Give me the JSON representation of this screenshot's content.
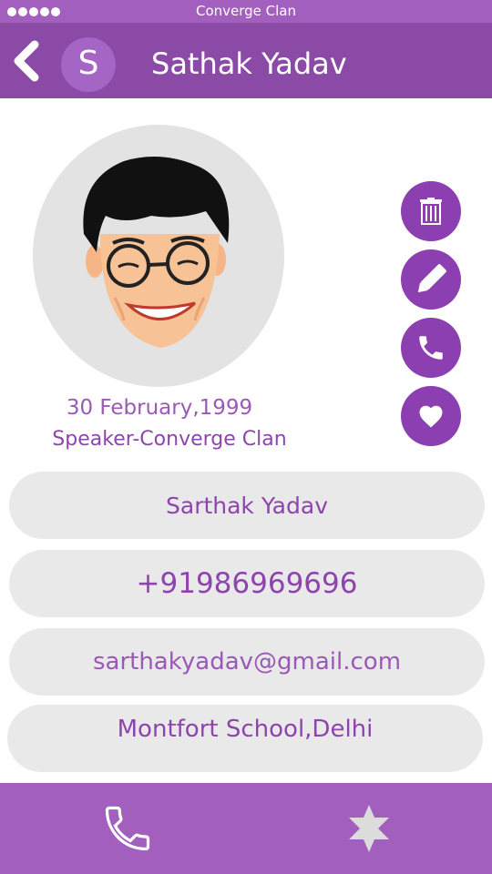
{
  "status_bar": {
    "title": "Converge Clan",
    "signal_dots": 5
  },
  "header": {
    "avatar_initial": "S",
    "title": "Sathak Yadav",
    "back_icon": "chevron-left-icon"
  },
  "profile": {
    "birth_date": "30 February,1999",
    "role": "Speaker-Converge Clan"
  },
  "actions": [
    {
      "name": "delete",
      "icon": "trash-icon"
    },
    {
      "name": "edit",
      "icon": "pencil-icon"
    },
    {
      "name": "call",
      "icon": "phone-icon"
    },
    {
      "name": "favorite",
      "icon": "heart-icon"
    }
  ],
  "fields": {
    "name": "Sarthak Yadav",
    "phone": "+91986969696",
    "email": "sarthakyadav@gmail.com",
    "school": "Montfort School,Delhi"
  },
  "bottom_nav": [
    {
      "name": "calls",
      "icon": "phone-icon"
    },
    {
      "name": "favorites",
      "icon": "star-icon"
    }
  ],
  "colors": {
    "header": "#8a4aa6",
    "status_bar": "#a35fbd",
    "accent": "#8b3fb0",
    "field_bg": "#e9e9e9",
    "text_accent": "#8e44ad"
  }
}
